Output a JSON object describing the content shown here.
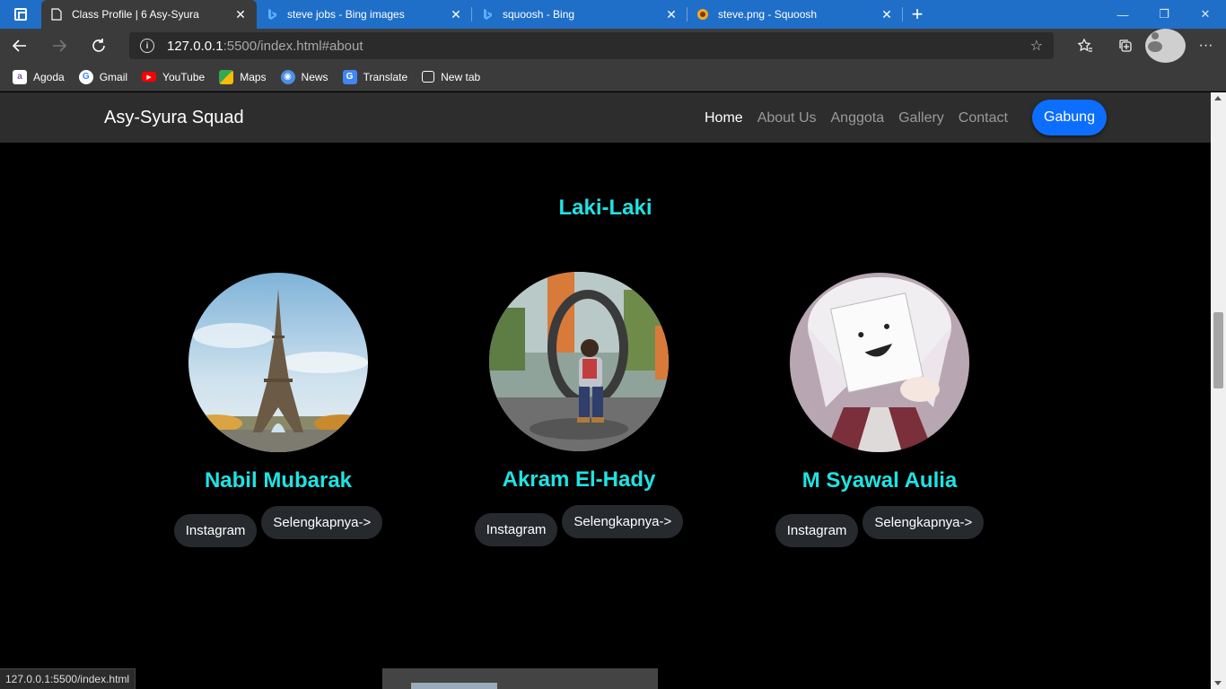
{
  "browser": {
    "tabs": [
      {
        "title": "Class Profile | 6 Asy-Syura",
        "icon": "page-icon",
        "active": true
      },
      {
        "title": "steve jobs - Bing images",
        "icon": "bing-icon",
        "active": false
      },
      {
        "title": "squoosh - Bing",
        "icon": "bing-icon",
        "active": false
      },
      {
        "title": "steve.png - Squoosh",
        "icon": "squoosh-icon",
        "active": false
      }
    ],
    "url_host": "127.0.0.1",
    "url_rest": ":5500/index.html#about",
    "bookmarks": [
      {
        "label": "Agoda",
        "icon": "agoda-icon",
        "color": "#8a5aa8"
      },
      {
        "label": "Gmail",
        "icon": "google-icon",
        "color": "#ffffff"
      },
      {
        "label": "YouTube",
        "icon": "youtube-icon",
        "color": "#ff0000"
      },
      {
        "label": "Maps",
        "icon": "maps-icon",
        "color": "#34a853"
      },
      {
        "label": "News",
        "icon": "news-icon",
        "color": "#4a90e2"
      },
      {
        "label": "Translate",
        "icon": "translate-icon",
        "color": "#4285f4"
      },
      {
        "label": "New tab",
        "icon": "newtab-icon",
        "color": "#3b3b3b"
      }
    ],
    "status_url": "127.0.0.1:5500/index.html"
  },
  "site": {
    "brand": "Asy-Syura Squad",
    "menu": [
      "Home",
      "About Us",
      "Anggota",
      "Gallery",
      "Contact"
    ],
    "active_menu": "Home",
    "join_label": "Gabung",
    "accent": "#1fe3e3",
    "button_color": "#0d6efd"
  },
  "section": {
    "title": "Laki-Laki",
    "members": [
      {
        "name": "Nabil Mubarak",
        "photo": "eiffel-tower-photo",
        "instagram_label": "Instagram",
        "more_label": "Selengkapnya->"
      },
      {
        "name": "Akram El-Hady",
        "photo": "boy-in-swing-chair-photo",
        "instagram_label": "Instagram",
        "more_label": "Selengkapnya->"
      },
      {
        "name": "M Syawal Aulia",
        "photo": "anime-character-photo",
        "instagram_label": "Instagram",
        "more_label": "Selengkapnya->"
      }
    ]
  }
}
